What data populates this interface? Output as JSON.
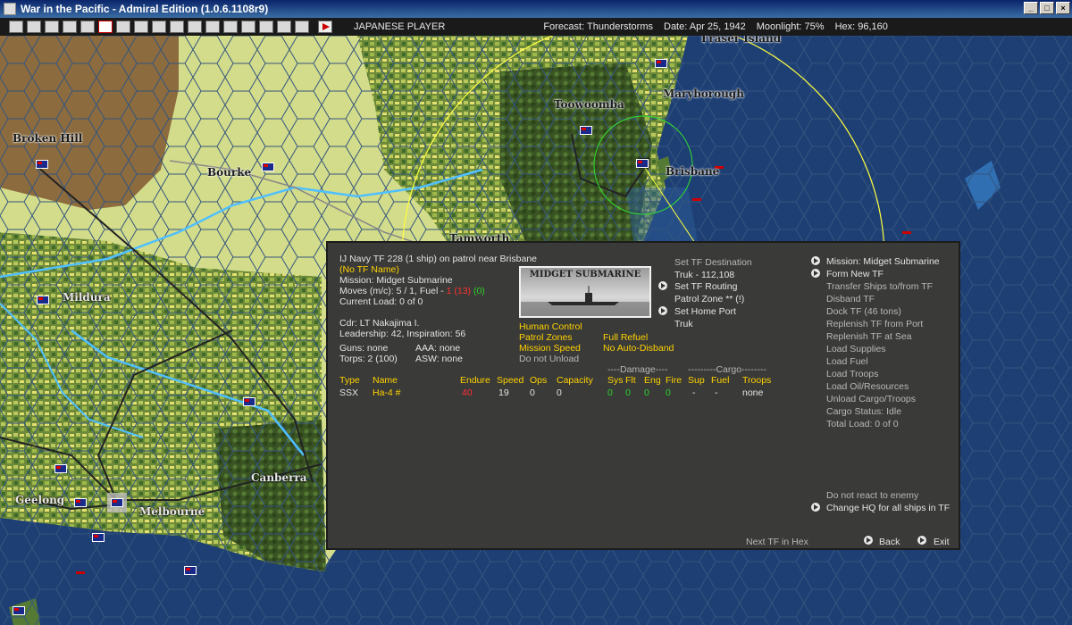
{
  "window": {
    "title": "War in the Pacific - Admiral Edition (1.0.6.1108r9)"
  },
  "toolbar": {
    "player": "JAPANESE PLAYER",
    "forecast": "Forecast: Thunderstorms",
    "date": "Date: Apr 25, 1942",
    "moonlight": "Moonlight: 75%",
    "hex": "Hex: 96,160",
    "button_icons": [
      "report-icon",
      "list-icon",
      "ground-icon",
      "air-icon",
      "info-icon",
      "rising-sun-icon",
      "ship-icon",
      "plane-icon",
      "flag-icon",
      "airgroup-icon",
      "sub-icon",
      "fleet-icon",
      "base-icon",
      "sync-icon",
      "op-icon",
      "orders-icon",
      "map-icon",
      "end-turn-icon"
    ]
  },
  "map": {
    "cities": [
      {
        "id": "fraser",
        "name": "Fraser Island"
      },
      {
        "id": "maryborough",
        "name": "Maryborough"
      },
      {
        "id": "toowoomba",
        "name": "Toowoomba"
      },
      {
        "id": "brisbane",
        "name": "Brisbane"
      },
      {
        "id": "broken-hill",
        "name": "Broken Hill"
      },
      {
        "id": "bourke",
        "name": "Bourke"
      },
      {
        "id": "tamworth",
        "name": "Tamworth"
      },
      {
        "id": "mildura",
        "name": "Mildura"
      },
      {
        "id": "canberra",
        "name": "Canberra"
      },
      {
        "id": "geelong",
        "name": "Geelong"
      },
      {
        "id": "melbourne",
        "name": "Melbourne"
      }
    ],
    "colors": {
      "ocean": "#1e3f73",
      "land_green": "#d3dc8a",
      "land_dark": "#3f5a25",
      "desert": "#8c6b3e",
      "route": "#ffff40",
      "range": "#30e030"
    }
  },
  "tf": {
    "header": "IJ Navy TF 228 (1 ship)  on patrol near Brisbane",
    "name": "(No TF Name)",
    "mission": "Mission: Midget Submarine",
    "moves_prefix": "Moves (m/c): 5 / 1, Fuel - ",
    "fuel_red": "1 (13)",
    "fuel_green": "(0)",
    "load": "Current Load: 0 of 0",
    "cdr": "Cdr: LT Nakajima I.",
    "leadership": "Leadership: 42, Inspiration: 56",
    "guns": "Guns: none",
    "aaa": "AAA: none",
    "torps": "Torps: 2 (100)",
    "asw": "ASW: none",
    "image_caption": "MIDGET SUBMARINE",
    "human_control": "Human Control",
    "patrol_zones": "Patrol Zones",
    "full_refuel": "Full Refuel",
    "mission_speed": "Mission Speed",
    "no_auto_disband": "No Auto-Disband",
    "do_not_unload": "Do not Unload",
    "destination_label": "Set TF Destination",
    "destination": "Truk - 112,108",
    "routing": "Set TF Routing",
    "patrol_zone": "Patrol Zone ** (!)",
    "home_port_label": "Set Home Port",
    "home_port": "Truk",
    "damage_header": "----Damage----",
    "cargo_header": "---------Cargo--------",
    "table_headers": {
      "type": "Type",
      "name": "Name",
      "endure": "Endure",
      "speed": "Speed",
      "ops": "Ops",
      "capacity": "Capacity",
      "sys": "Sys",
      "flt": "Flt",
      "eng": "Eng",
      "fire": "Fire",
      "sup": "Sup",
      "fuel": "Fuel",
      "troops": "Troops"
    },
    "ship": {
      "type": "SSX",
      "name": "Ha-4 #",
      "endure": "40",
      "speed": "19",
      "ops": "0",
      "capacity": "0",
      "sys": "0",
      "flt": "0",
      "eng": "0",
      "fire": "0",
      "sup": "-",
      "fuel": "-",
      "troops": "none"
    }
  },
  "actions": {
    "mission": "Mission: Midget Submarine",
    "form_new": "Form New TF",
    "transfer": "Transfer Ships to/from TF",
    "disband": "Disband TF",
    "dock": "Dock TF (46 tons)",
    "replenish_port": "Replenish TF from Port",
    "replenish_sea": "Replenish TF at Sea",
    "load_supplies": "Load Supplies",
    "load_fuel": "Load Fuel",
    "load_troops": "Load Troops",
    "load_oil": "Load Oil/Resources",
    "unload": "Unload Cargo/Troops",
    "cargo_status": "Cargo Status: Idle",
    "total_load": "Total Load: 0 of 0",
    "do_not_react": "Do not react to enemy",
    "change_hq": "Change HQ for all ships in TF",
    "next_tf": "Next TF in Hex",
    "back": "Back",
    "exit": "Exit"
  }
}
